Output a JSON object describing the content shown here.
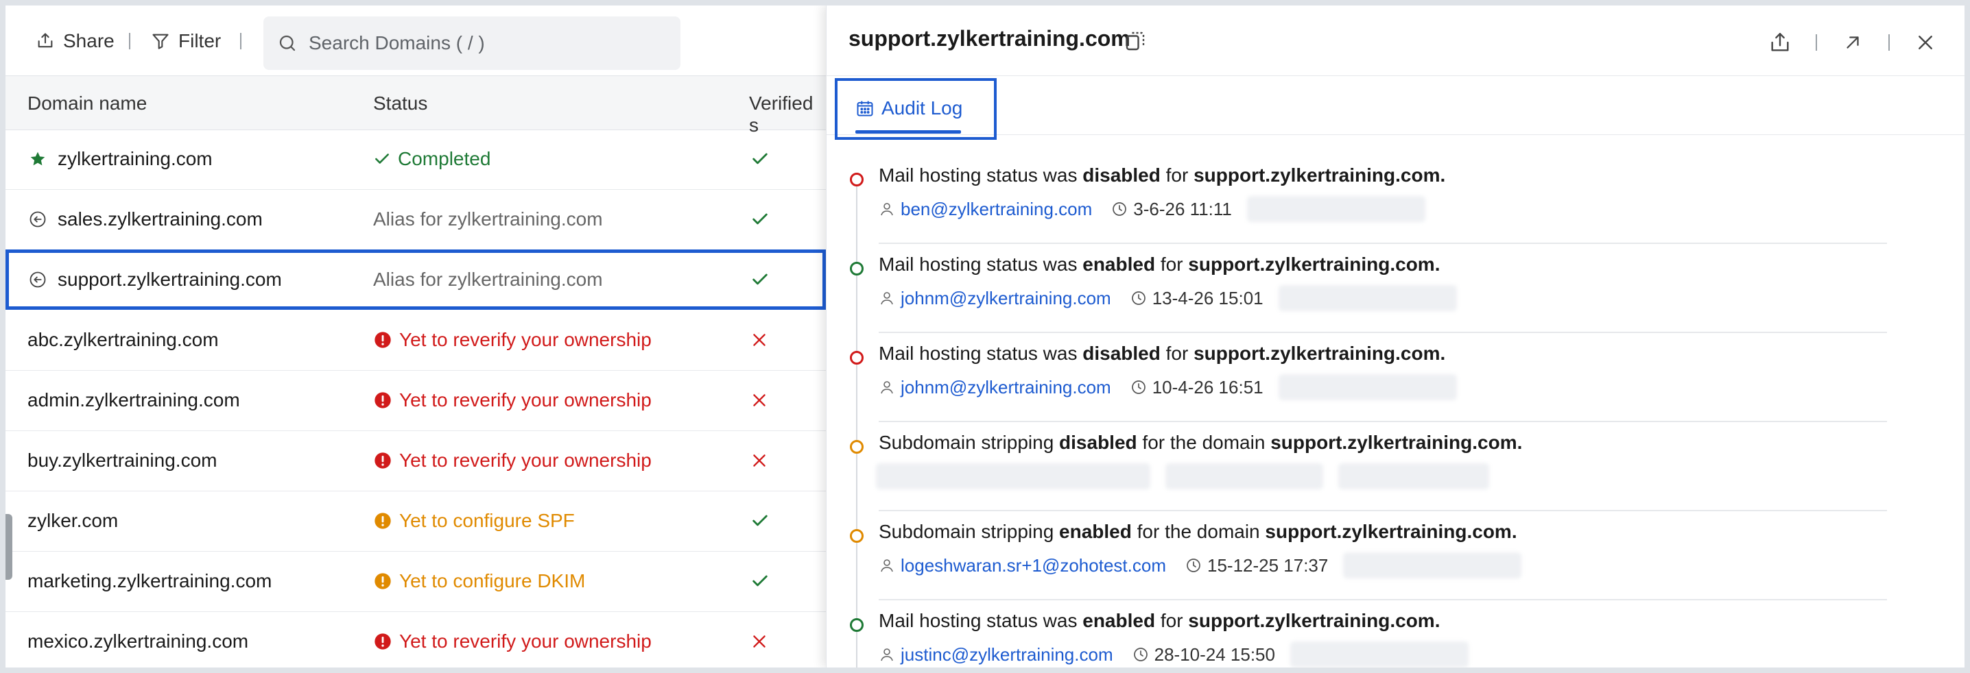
{
  "toolbar": {
    "share_label": "Share",
    "filter_label": "Filter",
    "search_placeholder": "Search Domains ( / )"
  },
  "table": {
    "columns": [
      "Domain name",
      "Status",
      "Verified s"
    ],
    "rows": [
      {
        "name": "zylkertraining.com",
        "icon": "star-icon",
        "status": "Completed",
        "status_kind": "completed",
        "verified": true
      },
      {
        "name": "sales.zylkertraining.com",
        "icon": "alias-arrow-icon",
        "status": "Alias for zylkertraining.com",
        "status_kind": "alias",
        "verified": true
      },
      {
        "name": "support.zylkertraining.com",
        "icon": "alias-arrow-icon",
        "status": "Alias for zylkertraining.com",
        "status_kind": "alias",
        "verified": true,
        "selected": true
      },
      {
        "name": "abc.zylkertraining.com",
        "icon": "",
        "status": "Yet to reverify your ownership",
        "status_kind": "error",
        "verified": false
      },
      {
        "name": "admin.zylkertraining.com",
        "icon": "",
        "status": "Yet to reverify your ownership",
        "status_kind": "error",
        "verified": false
      },
      {
        "name": "buy.zylkertraining.com",
        "icon": "",
        "status": "Yet to reverify your ownership",
        "status_kind": "error",
        "verified": false
      },
      {
        "name": "zylker.com",
        "icon": "",
        "status": "Yet to configure SPF",
        "status_kind": "warning",
        "verified": true
      },
      {
        "name": "marketing.zylkertraining.com",
        "icon": "",
        "status": "Yet to configure DKIM",
        "status_kind": "warning",
        "verified": true
      },
      {
        "name": "mexico.zylkertraining.com",
        "icon": "",
        "status": "Yet to reverify your ownership",
        "status_kind": "error",
        "verified": false
      }
    ]
  },
  "panel": {
    "title": "support.zylkertraining.com",
    "tab_label": "Audit Log",
    "entries": [
      {
        "parts": [
          [
            "Mail hosting status was ",
            false
          ],
          [
            "disabled",
            true
          ],
          [
            " for ",
            false
          ],
          [
            "support.zylkertraining.com.",
            true
          ]
        ],
        "dot": "red",
        "user": "ben@zylkertraining.com",
        "time": "3-6-26 11:11"
      },
      {
        "parts": [
          [
            "Mail hosting status was ",
            false
          ],
          [
            "enabled",
            true
          ],
          [
            " for ",
            false
          ],
          [
            "support.zylkertraining.com.",
            true
          ]
        ],
        "dot": "green",
        "user": "johnm@zylkertraining.com",
        "time": "13-4-26 15:01"
      },
      {
        "parts": [
          [
            "Mail hosting status was ",
            false
          ],
          [
            "disabled",
            true
          ],
          [
            " for ",
            false
          ],
          [
            "support.zylkertraining.com.",
            true
          ]
        ],
        "dot": "red",
        "user": "johnm@zylkertraining.com",
        "time": "10-4-26 16:51"
      },
      {
        "parts": [
          [
            "Subdomain stripping ",
            false
          ],
          [
            "disabled",
            true
          ],
          [
            " for the domain ",
            false
          ],
          [
            "support.zylkertraining.com.",
            true
          ]
        ],
        "dot": "orange",
        "user": "",
        "time": ""
      },
      {
        "parts": [
          [
            "Subdomain stripping ",
            false
          ],
          [
            "enabled",
            true
          ],
          [
            " for the domain ",
            false
          ],
          [
            "support.zylkertraining.com.",
            true
          ]
        ],
        "dot": "orange",
        "user": "logeshwaran.sr+1@zohotest.com",
        "time": "15-12-25 17:37"
      },
      {
        "parts": [
          [
            "Mail hosting status was ",
            false
          ],
          [
            "enabled",
            true
          ],
          [
            " for ",
            false
          ],
          [
            "support.zylkertraining.com.",
            true
          ]
        ],
        "dot": "green",
        "user": "justinc@zylkertraining.com",
        "time": "28-10-24 15:50"
      }
    ]
  },
  "colors": {
    "accent": "#1d5bd0",
    "green": "#1f7a36",
    "red": "#d11a1a",
    "orange": "#e08a00"
  }
}
